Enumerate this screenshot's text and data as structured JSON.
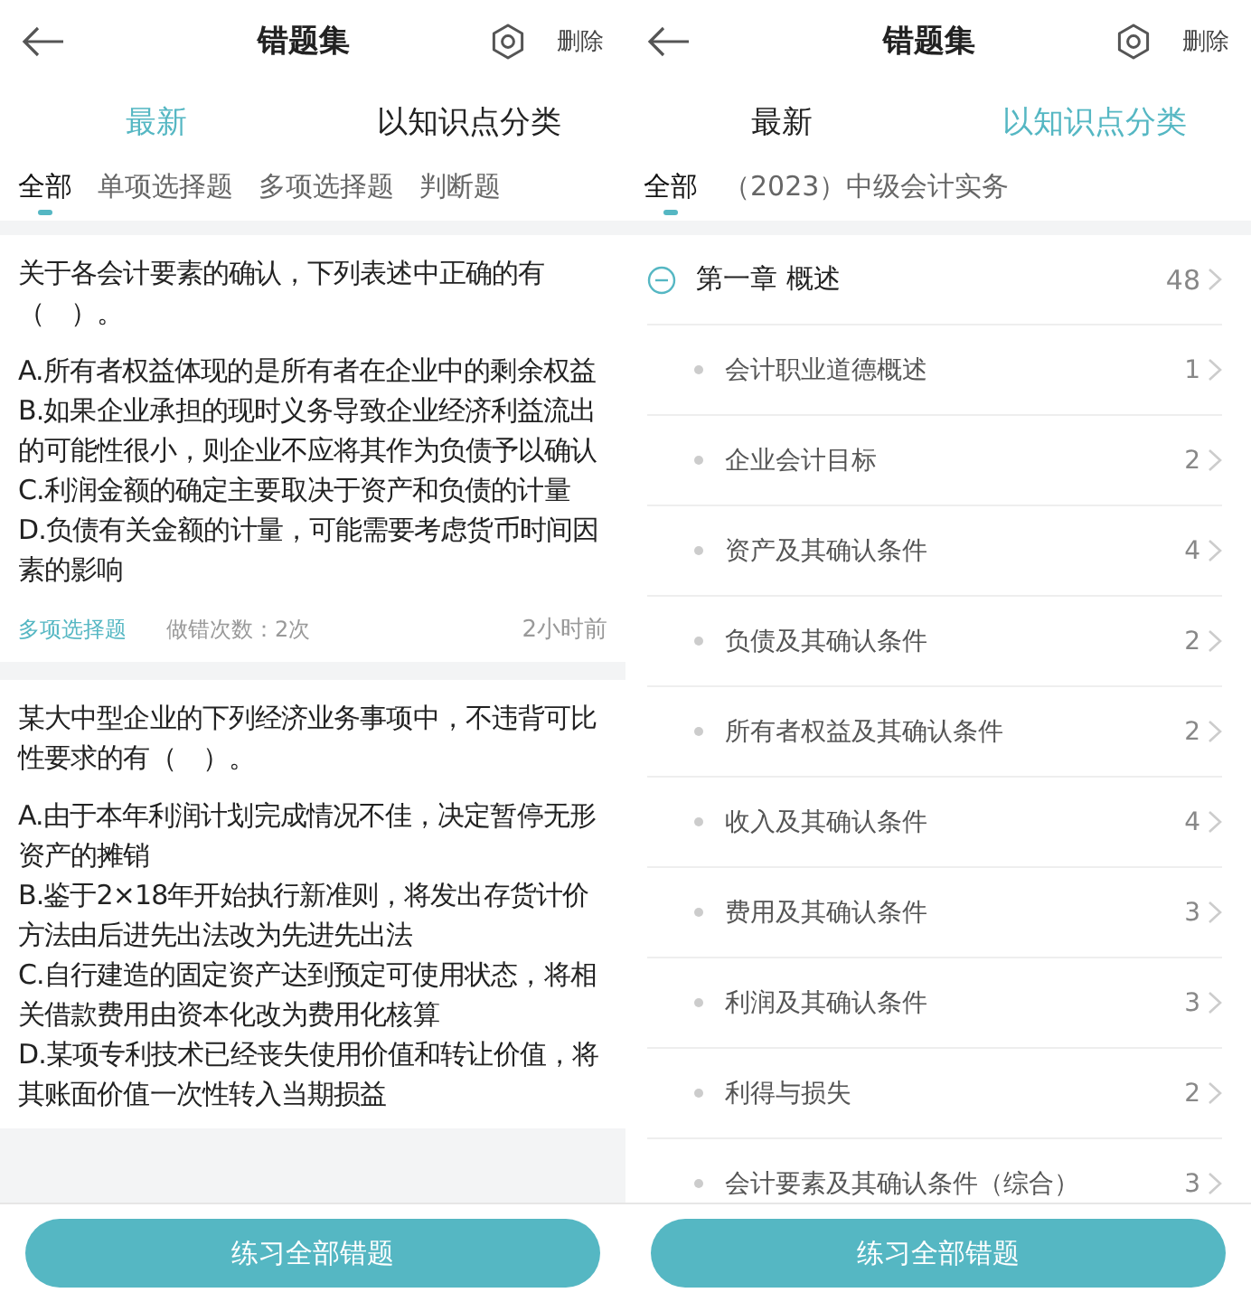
{
  "screens": [
    {
      "kind": "questions",
      "title": "错题集",
      "delete_label": "删除",
      "view_tabs": [
        {
          "label": "最新",
          "selected": true
        },
        {
          "label": "以知识点分类",
          "selected": false
        }
      ],
      "filter_tabs": [
        {
          "label": "全部",
          "selected": true
        },
        {
          "label": "单项选择题",
          "selected": false
        },
        {
          "label": "多项选择题",
          "selected": false
        },
        {
          "label": "判断题",
          "selected": false
        }
      ],
      "questions": [
        {
          "stem": "关于各会计要素的确认，下列表述中正确的有（　）。",
          "options": [
            "A.所有者权益体现的是所有者在企业中的剩余权益",
            "B.如果企业承担的现时义务导致企业经济利益流出的可能性很小，则企业不应将其作为负债予以确认",
            "C.利润金额的确定主要取决于资产和负债的计量",
            "D.负债有关金额的计量，可能需要考虑货币时间因素的影响"
          ],
          "type": "多项选择题",
          "wrong_count": "做错次数：2次",
          "time": "2小时前"
        },
        {
          "stem": "某大中型企业的下列经济业务事项中，不违背可比性要求的有（　）。",
          "options": [
            "A.由于本年利润计划完成情况不佳，决定暂停无形资产的摊销",
            "B.鉴于2×18年开始执行新准则，将发出存货计价方法由后进先出法改为先进先出法",
            "C.自行建造的固定资产达到预定可使用状态，将相关借款费用由资本化改为费用化核算",
            "D.某项专利技术已经丧失使用价值和转让价值，将其账面价值一次性转入当期损益"
          ]
        }
      ],
      "button": "练习全部错题"
    },
    {
      "kind": "chapters",
      "title": "错题集",
      "delete_label": "删除",
      "view_tabs": [
        {
          "label": "最新",
          "selected": false
        },
        {
          "label": "以知识点分类",
          "selected": true
        }
      ],
      "filter_tabs": [
        {
          "label": "全部",
          "selected": true
        },
        {
          "label": "（2023）中级会计实务",
          "selected": false
        }
      ],
      "chapters": [
        {
          "title": "第一章 概述",
          "count": "48",
          "expanded": true,
          "children": [
            {
              "title": "会计职业道德概述",
              "count": "1"
            },
            {
              "title": "企业会计目标",
              "count": "2"
            },
            {
              "title": "资产及其确认条件",
              "count": "4"
            },
            {
              "title": "负债及其确认条件",
              "count": "2"
            },
            {
              "title": "所有者权益及其确认条件",
              "count": "2"
            },
            {
              "title": "收入及其确认条件",
              "count": "4"
            },
            {
              "title": "费用及其确认条件",
              "count": "3"
            },
            {
              "title": "利润及其确认条件",
              "count": "3"
            },
            {
              "title": "利得与损失",
              "count": "2"
            },
            {
              "title": "会计要素及其确认条件（综合）",
              "count": "3"
            }
          ]
        }
      ],
      "button": "练习全部错题"
    }
  ]
}
